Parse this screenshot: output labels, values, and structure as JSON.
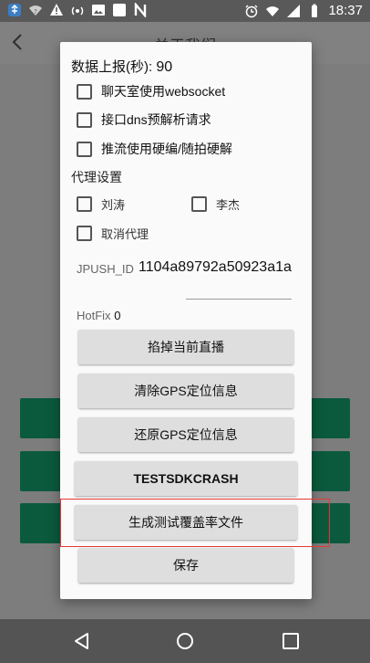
{
  "status_bar": {
    "time": "18:37",
    "left_icons": [
      "usb-icon",
      "wifi-question-icon",
      "warning-icon",
      "hotspot-icon",
      "image-icon",
      "square-icon",
      "n-icon"
    ],
    "right_icons": [
      "alarm-icon",
      "wifi-icon",
      "signal-icon",
      "battery-icon"
    ]
  },
  "background": {
    "title": "关于我们"
  },
  "dialog": {
    "report_label": "数据上报(秒):",
    "report_value": "90",
    "checkboxes": [
      {
        "label": "聊天室使用websocket",
        "checked": false
      },
      {
        "label": "接口dns预解析请求",
        "checked": false
      },
      {
        "label": "推流使用硬编/随拍硬解",
        "checked": false
      }
    ],
    "proxy_section": "代理设置",
    "proxy_options": [
      {
        "label": "刘涛",
        "checked": false
      },
      {
        "label": "李杰",
        "checked": false
      },
      {
        "label": "取消代理",
        "checked": false
      }
    ],
    "jpush_label": "JPUSH_ID",
    "jpush_value": "1104a89792a50923a1a",
    "hotfix_label": "HotFix",
    "hotfix_value": "0",
    "buttons": [
      {
        "label": "掐掉当前直播"
      },
      {
        "label": "清除GPS定位信息"
      },
      {
        "label": "还原GPS定位信息"
      },
      {
        "label": "TESTSDKCRASH"
      },
      {
        "label": "生成测试覆盖率文件"
      },
      {
        "label": "保存"
      }
    ]
  },
  "colors": {
    "accent_green": "#0b5a3d",
    "highlight_red": "#e53935"
  }
}
